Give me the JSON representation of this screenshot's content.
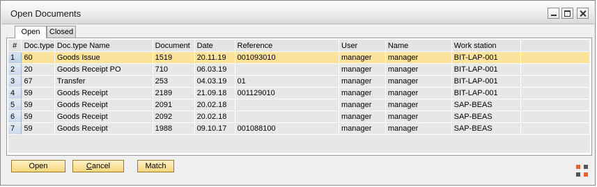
{
  "window": {
    "title": "Open Documents"
  },
  "tabs": [
    {
      "label": "Open"
    },
    {
      "label": "Closed"
    }
  ],
  "table": {
    "columns": [
      "#",
      "Doc.type",
      "Doc.type Name",
      "Document",
      "Date",
      "Reference",
      "User",
      "Name",
      "Work station"
    ],
    "rows": [
      [
        "1",
        "60",
        "Goods Issue",
        "1519",
        "20.11.19",
        "001093010",
        "manager",
        "manager",
        "BIT-LAP-001"
      ],
      [
        "2",
        "20",
        "Goods Receipt PO",
        "710",
        "06.03.19",
        "",
        "manager",
        "manager",
        "BIT-LAP-001"
      ],
      [
        "3",
        "67",
        "Transfer",
        "253",
        "04.03.19",
        "01",
        "manager",
        "manager",
        "BIT-LAP-001"
      ],
      [
        "4",
        "59",
        "Goods Receipt",
        "2189",
        "21.09.18",
        "001129010",
        "manager",
        "manager",
        "BIT-LAP-001"
      ],
      [
        "5",
        "59",
        "Goods Receipt",
        "2091",
        "20.02.18",
        "",
        "manager",
        "manager",
        "SAP-BEAS"
      ],
      [
        "6",
        "59",
        "Goods Receipt",
        "2092",
        "20.02.18",
        "",
        "manager",
        "manager",
        "SAP-BEAS"
      ],
      [
        "7",
        "59",
        "Goods Receipt",
        "1988",
        "09.10.17",
        "001088100",
        "manager",
        "manager",
        "SAP-BEAS"
      ]
    ]
  },
  "buttons": {
    "open": "Open",
    "cancel_first": "C",
    "cancel_rest": "ancel",
    "match": "Match"
  },
  "colors": {
    "selected_row": "#fde29b",
    "button": "#f5d67a",
    "corner_icon": "#e8622c"
  }
}
